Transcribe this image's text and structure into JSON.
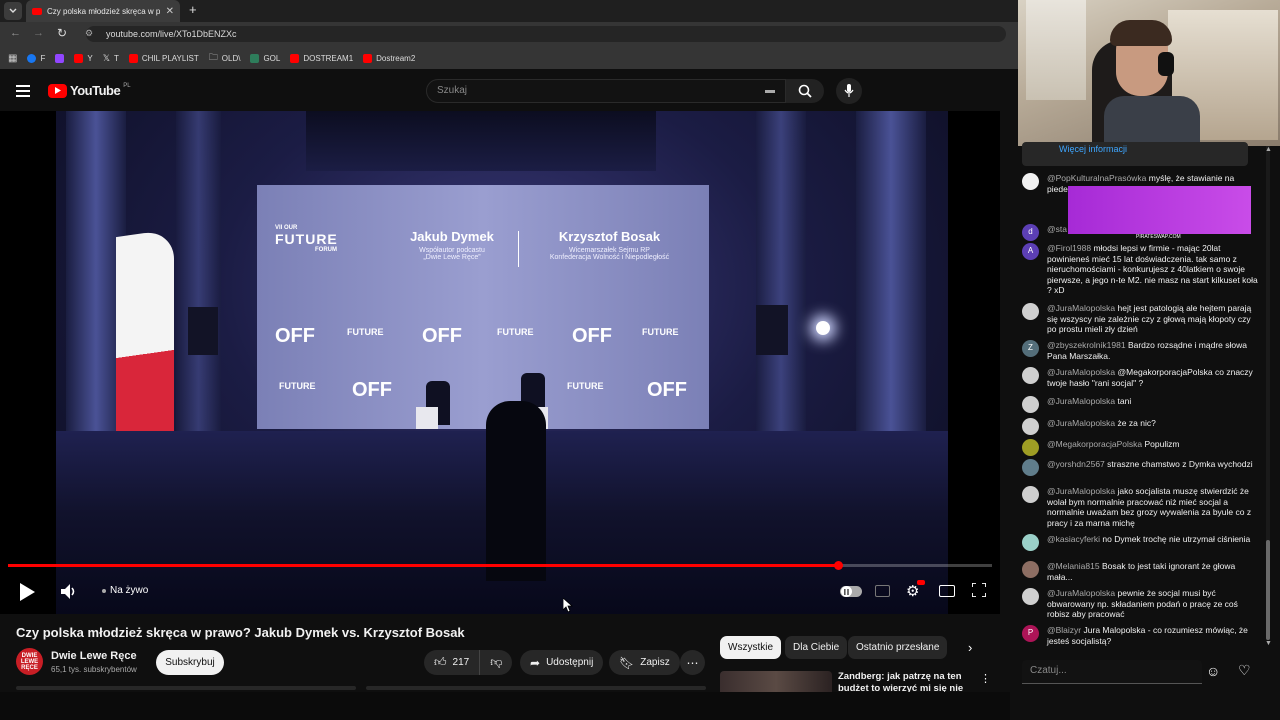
{
  "browser": {
    "tab_title": "Czy polska młodzież skręca w p",
    "url": "youtube.com/live/XTo1DbENZXc",
    "bookmarks": [
      "F",
      "Y",
      "T",
      "CHIL PLAYLIST",
      "OLD\\",
      "GOL",
      "DOSTREAM1",
      "Dostream2"
    ]
  },
  "youtube": {
    "logo": "YouTube",
    "country": "PL",
    "search_placeholder": "Szukaj"
  },
  "video": {
    "screen": {
      "forum_small": "VII OUR",
      "forum_big": "FUTURE",
      "forum_sub": "FORUM",
      "speaker1_name": "Jakub Dymek",
      "speaker1_role_line1": "Współautor podcastu",
      "speaker1_role_line2": "„Dwie Lewe Ręce”",
      "speaker2_name": "Krzysztof Bosak",
      "speaker2_role_line1": "Wicemarszałek Sejmu RP",
      "speaker2_role_line2": "Konfederacja Wolność i Niepodległość",
      "off_logo": "OFF"
    },
    "live_label": "Na żywo",
    "progress_fraction": 0.84,
    "title": "Czy polska młodzież skręca w prawo? Jakub Dymek vs. Krzysztof Bosak"
  },
  "channel": {
    "avatar_text": "DWIE LEWE RĘCE",
    "name": "Dwie Lewe Ręce",
    "subscribers": "65,1 tys. subskrybentów",
    "subscribe_label": "Subskrybuj"
  },
  "actions": {
    "likes": "217",
    "share_label": "Udostępnij",
    "save_label": "Zapisz"
  },
  "chips": [
    "Wszystkie",
    "Dla Ciebie",
    "Ostatnio przesłane"
  ],
  "recommendation": {
    "title": "Zandberg: jak patrzę na ten budżet to wierzyć mi się nie"
  },
  "chat": {
    "more_info": "Więcej informacji",
    "ad_label": "PIRATESWAP.COM",
    "input_placeholder": "Czatuj...",
    "messages": [
      {
        "author": "@PopKulturalnaPrasówka",
        "text": "myślę, że stawianie na piedestale kogo instru",
        "avatar_color": "#f1f1f1",
        "initial": ""
      },
      {
        "author": "@sta",
        "text": "",
        "avatar_color": "#5c3fb5",
        "initial": "d"
      },
      {
        "author": "@Firol1988",
        "text": "młodsi lepsi w firmie - mając 20lat powinieneś mieć 15 lat doświadczenia. tak samo z nieruchomościami - konkurujesz z 40latkiem o swoje pierwsze, a jego n-te M2. nie masz na start kilkuset koła ? xD",
        "avatar_color": "#5c3fb5",
        "initial": "A"
      },
      {
        "author": "@JuraMalopolska",
        "text": "hejt jest patologią ale hejtem parają się wszyscy nie zależnie czy z głową mają kłopoty czy po prostu mieli zły dzień",
        "avatar_color": "#cfcfcf",
        "initial": ""
      },
      {
        "author": "@zbyszekrolnik1981",
        "text": "Bardzo rozsądne i mądre słowa Pana Marszałka.",
        "avatar_color": "#546e7a",
        "initial": "Z"
      },
      {
        "author": "@JuraMalopolska",
        "text": "@MegakorporacjaPolska co znaczy twoje hasło \"rani socjal\" ?",
        "avatar_color": "#cfcfcf",
        "initial": ""
      },
      {
        "author": "@JuraMalopolska",
        "text": "tani",
        "avatar_color": "#cfcfcf",
        "initial": ""
      },
      {
        "author": "@JuraMalopolska",
        "text": "że za nic?",
        "avatar_color": "#cfcfcf",
        "initial": ""
      },
      {
        "author": "@MegakorporacjaPolska",
        "text": "Populizm",
        "avatar_color": "#9e9d24",
        "initial": ""
      },
      {
        "author": "@yorshdn2567",
        "text": "straszne chamstwo z Dymka wychodzi",
        "avatar_color": "#607d8b",
        "initial": ""
      },
      {
        "author": "@JuraMalopolska",
        "text": "jako socjalista muszę stwierdzić że wolał bym normalnie pracować niż mieć socjal a normalnie uważam bez grozy wywalenia za byule co z pracy i za marna michę",
        "avatar_color": "#cfcfcf",
        "initial": ""
      },
      {
        "author": "@kasiacyferki",
        "text": "no Dymek trochę nie utrzymał ciśnienia",
        "avatar_color": "#9ad0c8",
        "initial": ""
      },
      {
        "author": "@Melania815",
        "text": "Bosak to jest taki ignorant że głowa mała...",
        "avatar_color": "#8d6e63",
        "initial": ""
      },
      {
        "author": "@JuraMalopolska",
        "text": "pewnie że socjal musi być obwarowany np. składaniem podań o pracę ze coś robisz aby pracować",
        "avatar_color": "#cfcfcf",
        "initial": ""
      },
      {
        "author": "@Blaizyr",
        "text": "Jura Malopolska - co rozumiesz mówiąc, że jesteś socjalistą?",
        "avatar_color": "#ad1457",
        "initial": "P"
      }
    ]
  }
}
